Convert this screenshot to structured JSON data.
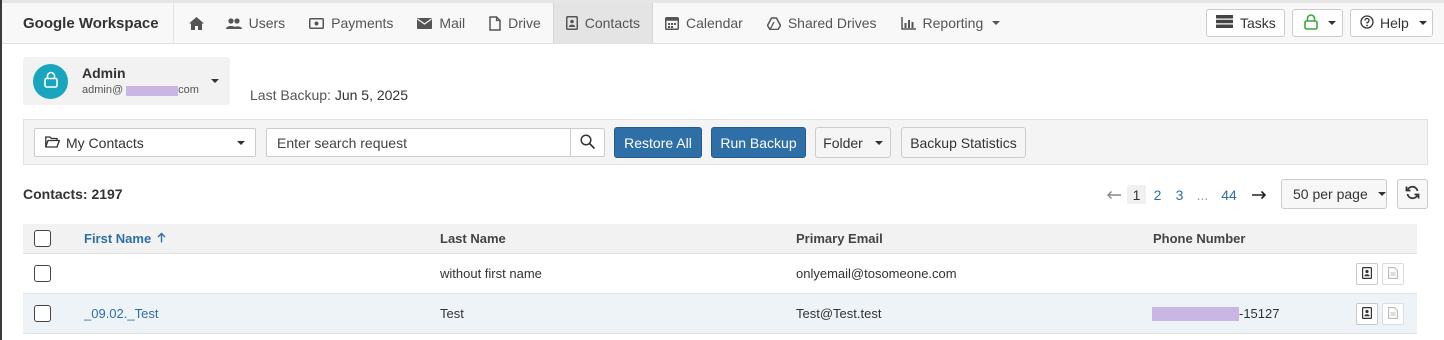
{
  "brand": "Google Workspace",
  "nav": {
    "items": [
      {
        "label": "Users",
        "icon": "users-icon"
      },
      {
        "label": "Payments",
        "icon": "payments-icon"
      },
      {
        "label": "Mail",
        "icon": "mail-icon"
      },
      {
        "label": "Drive",
        "icon": "file-icon"
      },
      {
        "label": "Contacts",
        "icon": "contacts-icon",
        "active": true
      },
      {
        "label": "Calendar",
        "icon": "calendar-icon"
      },
      {
        "label": "Shared Drives",
        "icon": "shared-drive-icon"
      },
      {
        "label": "Reporting",
        "icon": "bar-chart-icon",
        "dropdown": true
      }
    ],
    "tasks_label": "Tasks",
    "help_label": "Help"
  },
  "account": {
    "name": "Admin",
    "email_prefix": "admin@",
    "email_suffix": "com"
  },
  "last_backup": {
    "label": "Last Backup:",
    "value": "Jun 5, 2025"
  },
  "toolbar": {
    "folder_select": "My Contacts",
    "search_placeholder": "Enter search request",
    "restore_all": "Restore All",
    "run_backup": "Run Backup",
    "folder": "Folder",
    "backup_statistics": "Backup Statistics"
  },
  "contacts_count": "Contacts: 2197",
  "pagination": {
    "pages": [
      "1",
      "2",
      "3"
    ],
    "ellipsis": "...",
    "last": "44",
    "current": "1",
    "per_page": "50 per page"
  },
  "table": {
    "headers": {
      "first_name": "First Name",
      "last_name": "Last Name",
      "primary_email": "Primary Email",
      "phone_number": "Phone Number"
    },
    "rows": [
      {
        "first_name": "",
        "last_name": "without first name",
        "email": "onlyemail@tosomeone.com",
        "phone_suffix": ""
      },
      {
        "first_name": "_09.02._Test",
        "last_name": "Test",
        "email": "Test@Test.test",
        "phone_suffix": "-15127"
      }
    ]
  },
  "colors": {
    "primary": "#2f6fa8",
    "avatar": "#1aa5bf",
    "redaction": "#c9b6e3",
    "status_green": "#3aa83a"
  }
}
